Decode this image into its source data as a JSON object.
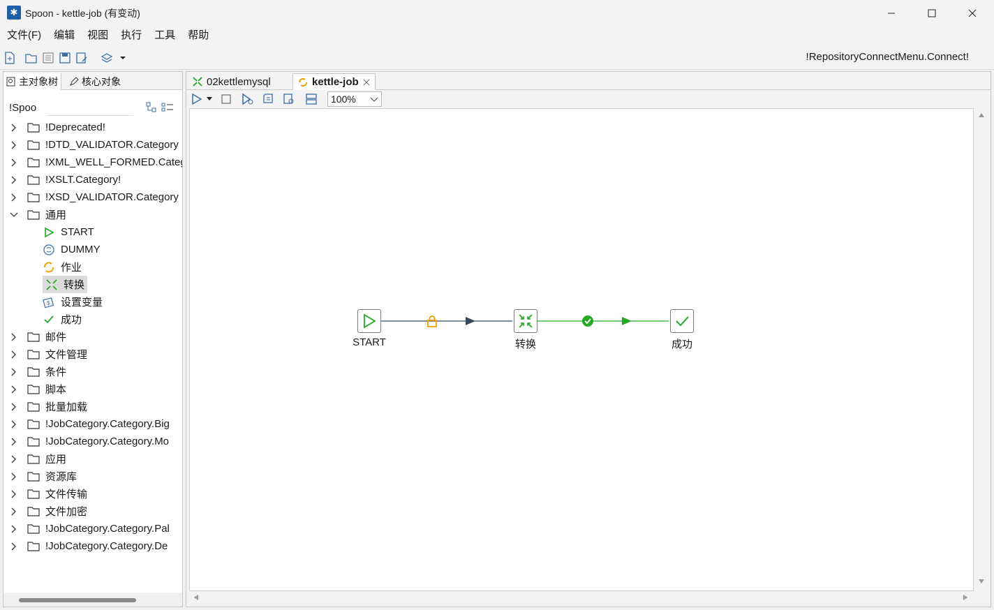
{
  "window": {
    "title": "Spoon - kettle-job (有变动)",
    "app_icon": "spoon-icon",
    "controls": [
      "minimize-icon",
      "maximize-icon",
      "close-icon"
    ]
  },
  "menu": [
    "文件(F)",
    "编辑",
    "视图",
    "执行",
    "工具",
    "帮助"
  ],
  "toolbar": {
    "icons": [
      "new-file-icon",
      "open-icon",
      "explore-icon",
      "save-icon",
      "save-as-icon",
      "layers-icon"
    ],
    "repository_connect": "!RepositoryConnectMenu.Connect!"
  },
  "left_panel": {
    "tabs": [
      {
        "label": "主对象树",
        "icon": "object-tree-icon"
      },
      {
        "label": "核心对象",
        "icon": "pencil-icon"
      }
    ],
    "search_label": "!Spoo",
    "search_value": "",
    "tree": [
      {
        "label": "!Deprecated!",
        "type": "folder",
        "expanded": false
      },
      {
        "label": "!DTD_VALIDATOR.Category",
        "type": "folder",
        "expanded": false
      },
      {
        "label": "!XML_WELL_FORMED.Categ",
        "type": "folder",
        "expanded": false
      },
      {
        "label": "!XSLT.Category!",
        "type": "folder",
        "expanded": false
      },
      {
        "label": "!XSD_VALIDATOR.Category",
        "type": "folder",
        "expanded": false
      },
      {
        "label": "通用",
        "type": "folder",
        "expanded": true
      },
      {
        "label": "START",
        "type": "leaf",
        "icon": "start-icon"
      },
      {
        "label": "DUMMY",
        "type": "leaf",
        "icon": "dummy-icon"
      },
      {
        "label": "作业",
        "type": "leaf",
        "icon": "job-icon"
      },
      {
        "label": "转换",
        "type": "leaf",
        "icon": "transformation-icon",
        "selected": true
      },
      {
        "label": "设置变量",
        "type": "leaf",
        "icon": "set-variable-icon"
      },
      {
        "label": "成功",
        "type": "leaf",
        "icon": "success-icon"
      },
      {
        "label": "邮件",
        "type": "folder",
        "expanded": false
      },
      {
        "label": "文件管理",
        "type": "folder",
        "expanded": false
      },
      {
        "label": "条件",
        "type": "folder",
        "expanded": false
      },
      {
        "label": "脚本",
        "type": "folder",
        "expanded": false
      },
      {
        "label": "批量加载",
        "type": "folder",
        "expanded": false
      },
      {
        "label": "!JobCategory.Category.Big",
        "type": "folder",
        "expanded": false
      },
      {
        "label": "!JobCategory.Category.Mo",
        "type": "folder",
        "expanded": false
      },
      {
        "label": "应用",
        "type": "folder",
        "expanded": false
      },
      {
        "label": "资源库",
        "type": "folder",
        "expanded": false
      },
      {
        "label": "文件传输",
        "type": "folder",
        "expanded": false
      },
      {
        "label": "文件加密",
        "type": "folder",
        "expanded": false
      },
      {
        "label": "!JobCategory.Category.Pal",
        "type": "folder",
        "expanded": false
      },
      {
        "label": "!JobCategory.Category.De",
        "type": "folder",
        "expanded": false
      }
    ]
  },
  "editor": {
    "tabs": [
      {
        "label": "02kettlemysql",
        "icon": "transformation-icon",
        "active": false
      },
      {
        "label": "kettle-job",
        "icon": "job-icon",
        "active": true,
        "closable": true
      }
    ],
    "canvas_toolbar_icons": [
      "run-icon",
      "run-dropdown-icon",
      "stop-icon",
      "preview-icon",
      "debug-icon",
      "sql-icon",
      "explorer-icon"
    ],
    "zoom": "100%",
    "nodes": [
      {
        "id": "start",
        "label": "START",
        "icon": "start-icon"
      },
      {
        "id": "transform",
        "label": "转换",
        "icon": "transformation-icon"
      },
      {
        "id": "success",
        "label": "成功",
        "icon": "success-icon"
      }
    ],
    "hops": [
      {
        "from": "start",
        "to": "transform",
        "type": "unconditional",
        "color": "#34495e",
        "marker": "lock-icon"
      },
      {
        "from": "transform",
        "to": "success",
        "type": "on-success",
        "color": "#22aa22",
        "marker": "check-circle-icon"
      }
    ]
  },
  "colors": {
    "accent_green": "#22aa22",
    "lock_orange": "#f0a000",
    "hop_dark": "#34495e",
    "job_orange": "#f0a000"
  }
}
